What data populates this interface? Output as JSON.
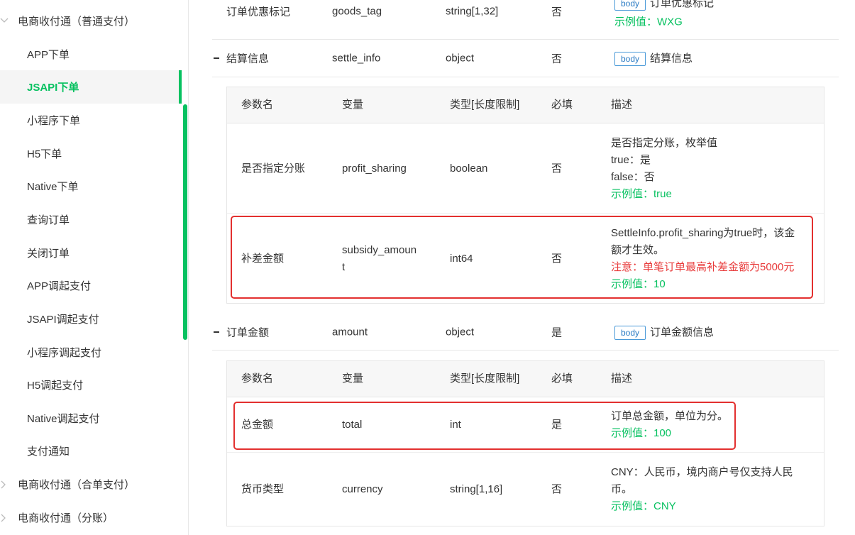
{
  "sidebar": {
    "group_1": "电商收付通（普通支付）",
    "items": [
      "APP下单",
      "JSAPI下单",
      "小程序下单",
      "H5下单",
      "Native下单",
      "查询订单",
      "关闭订单",
      "APP调起支付",
      "JSAPI调起支付",
      "小程序调起支付",
      "H5调起支付",
      "Native调起支付",
      "支付通知"
    ],
    "active_item": "JSAPI下单",
    "group_2": "电商收付通（合单支付）",
    "group_3": "电商收付通（分账）"
  },
  "badge_label": "body",
  "rows": {
    "goods_tag": {
      "name": "订单优惠标记",
      "var": "goods_tag",
      "type": "string[1,32]",
      "required": "否",
      "desc": "订单优惠标记",
      "example": "示例值：WXG"
    },
    "settle_info": {
      "name": "结算信息",
      "var": "settle_info",
      "type": "object",
      "required": "否",
      "desc": "结算信息"
    },
    "amount": {
      "name": "订单金额",
      "var": "amount",
      "type": "object",
      "required": "是",
      "desc": "订单金额信息"
    }
  },
  "subtable_header": {
    "name": "参数名",
    "var": "变量",
    "type": "类型[长度限制]",
    "required": "必填",
    "desc": "描述"
  },
  "settle_sub": {
    "profit_sharing": {
      "name": "是否指定分账",
      "var": "profit_sharing",
      "type": "boolean",
      "required": "否",
      "desc_1": "是否指定分账，枚举值",
      "desc_2": "true：是",
      "desc_3": "false：否",
      "example": "示例值：true"
    },
    "subsidy_amount": {
      "name": "补差金额",
      "var_1": "subsidy_amoun",
      "var_2": "t",
      "type": "int64",
      "required": "否",
      "desc_1": "SettleInfo.profit_sharing为true时，该金",
      "desc_2": "额才生效。",
      "warning": "注意：单笔订单最高补差金额为5000元",
      "example": "示例值：10"
    }
  },
  "amount_sub": {
    "total": {
      "name": "总金额",
      "var": "total",
      "type": "int",
      "required": "是",
      "desc": "订单总金额，单位为分。",
      "example": "示例值：100"
    },
    "currency": {
      "name": "货币类型",
      "var": "currency",
      "type": "string[1,16]",
      "required": "否",
      "desc_1": "CNY：人民币，境内商户号仅支持人民",
      "desc_2": "币。",
      "example": "示例值：CNY"
    }
  },
  "colors": {
    "accent": "#07c160",
    "highlight": "#e3302f",
    "warning": "#e83a3a",
    "badge": "#2a7bc4"
  }
}
